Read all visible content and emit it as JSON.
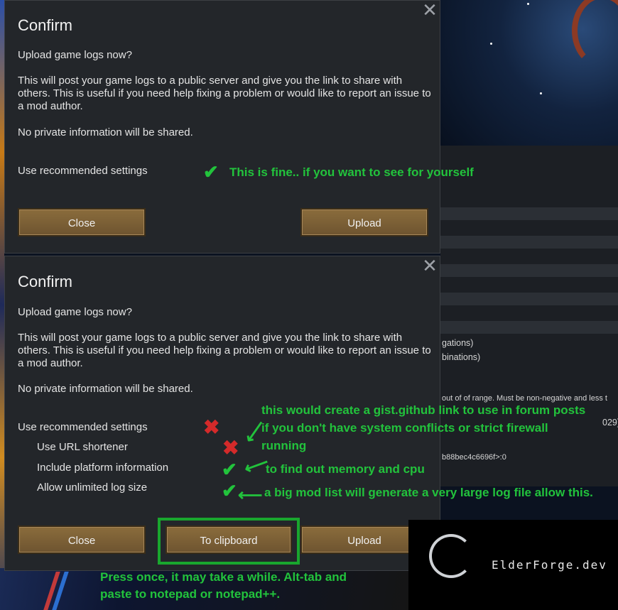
{
  "background": {
    "lines": [
      "gations)",
      "binations)",
      "out of of range. Must be non-negative and less t",
      "029]",
      "b88bec4c6696f>:0"
    ]
  },
  "dialog_top": {
    "title": "Confirm",
    "question": "Upload game logs now?",
    "description": "This will post your game logs to a public server and give you the link to share with others. This is useful if you need help fixing a problem or would like to report an issue to a mod author.",
    "privacy": "No private information will be shared.",
    "recommended_label": "Use recommended settings",
    "close_label": "Close",
    "upload_label": "Upload"
  },
  "dialog_bottom": {
    "title": "Confirm",
    "question": "Upload game logs now?",
    "description": "This will post your game logs to a public server and give you the link to share with others. This is useful if you need help fixing a problem or would like to report an issue to a mod author.",
    "privacy": "No private information will be shared.",
    "options": [
      {
        "label": "Use recommended settings",
        "checked": false
      },
      {
        "label": "Use URL shortener",
        "checked": false
      },
      {
        "label": "Include platform information",
        "checked": true
      },
      {
        "label": "Allow unlimited log size",
        "checked": true
      }
    ],
    "close_label": "Close",
    "clipboard_label": "To clipboard",
    "upload_label": "Upload"
  },
  "annotations": {
    "fine": "This is fine.. if you want to see for yourself",
    "gist_line1": "this would create a gist.github link to use in forum posts",
    "gist_line2": "if you don't have system conflicts or strict firewall",
    "gist_line3": "running",
    "platform": "to find out memory and cpu",
    "logsize": "a big mod list will generate a very large log file allow this.",
    "clipboard_line1": "Press once, it may take a while. Alt-tab and",
    "clipboard_line2": "paste to notepad or notepad++."
  },
  "logo": {
    "text": "ElderForge.dev"
  },
  "colors": {
    "annotation": "#22c33c",
    "cross": "#d42a2a",
    "button": "#7c603a",
    "dialog": "#23262a"
  }
}
